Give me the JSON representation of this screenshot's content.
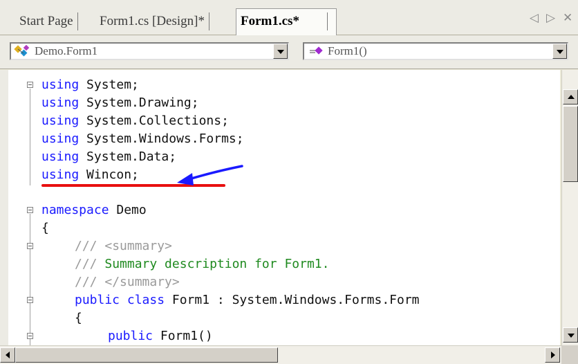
{
  "tabs": [
    {
      "label": "Start Page",
      "active": false
    },
    {
      "label": "Form1.cs [Design]*",
      "active": false
    },
    {
      "label": "Form1.cs*",
      "active": true
    }
  ],
  "tab_controls": {
    "left": "◁",
    "right": "▷",
    "close": "✕"
  },
  "dropdowns": {
    "class_selector": {
      "value": "Demo.Form1",
      "icon": "class-icon"
    },
    "member_selector": {
      "value": "Form1()",
      "icon": "method-icon"
    }
  },
  "code_lines": [
    {
      "kw": "using",
      "rest": " System;"
    },
    {
      "kw": "using",
      "rest": " System.Drawing;"
    },
    {
      "kw": "using",
      "rest": " System.Collections;"
    },
    {
      "kw": "using",
      "rest": " System.Windows.Forms;"
    },
    {
      "kw": "using",
      "rest": " System.Data;"
    },
    {
      "kw": "using",
      "rest": " Wincon;"
    },
    {
      "kw": "",
      "rest": ""
    },
    {
      "kw": "namespace",
      "rest": " Demo"
    },
    {
      "kw": "",
      "rest": "{"
    },
    {
      "xd_prefix": "/// ",
      "xml": "<summary>"
    },
    {
      "xd_prefix": "/// ",
      "comment": "Summary description for Form1."
    },
    {
      "xd_prefix": "/// ",
      "xml": "</summary>"
    },
    {
      "kw": "public class",
      "rest": " Form1 : System.Windows.Forms.Form"
    },
    {
      "kw": "",
      "rest": "{"
    },
    {
      "kw": "public",
      "rest": " Form1()"
    }
  ],
  "colors": {
    "keyword": "#1a1aff",
    "comment": "#1f8a1f",
    "xml_doc": "#9a9a9a",
    "annotation_underline": "#e81010",
    "annotation_arrow": "#1a1aff"
  }
}
